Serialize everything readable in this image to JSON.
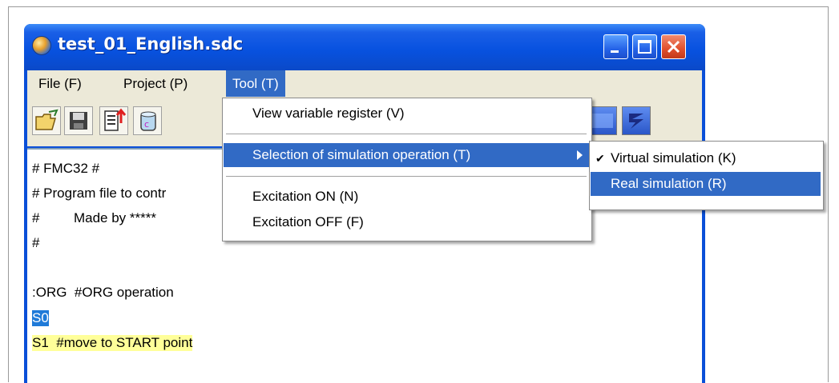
{
  "window": {
    "title": "test_01_English.sdc"
  },
  "menubar": {
    "items": [
      "File (F)",
      "Project (P)",
      "Tool (T)"
    ]
  },
  "toolbar": {
    "icons": [
      "open-folder-icon",
      "save-icon",
      "import-icon",
      "database-icon",
      "variable-icon",
      "lightning-icon"
    ]
  },
  "editor": {
    "lines": [
      "# FMC32 #",
      "# Program file to contr",
      "#         Made by *****",
      "#",
      "",
      ":ORG  #ORG operation",
      "S0",
      "S1  #move to START point"
    ]
  },
  "tool_menu": {
    "items": [
      {
        "label": "View variable register (V)"
      },
      {
        "label": "Selection of simulation operation (T)",
        "has_submenu": true,
        "highlighted": true
      },
      {
        "label": "Excitation ON (N)"
      },
      {
        "label": "Excitation OFF (F)"
      }
    ]
  },
  "submenu": {
    "items": [
      {
        "label": "Virtual simulation (K)",
        "checked": true,
        "check_glyph": "✔"
      },
      {
        "label": "Real simulation (R)",
        "highlighted": true
      }
    ]
  },
  "colors": {
    "titlebar": "#0852e0",
    "menu_highlight": "#316ac5",
    "menubar_bg": "#ece9d8",
    "line_highlight_blue": "#1f7ad8",
    "line_highlight_yellow": "#ffff99"
  }
}
